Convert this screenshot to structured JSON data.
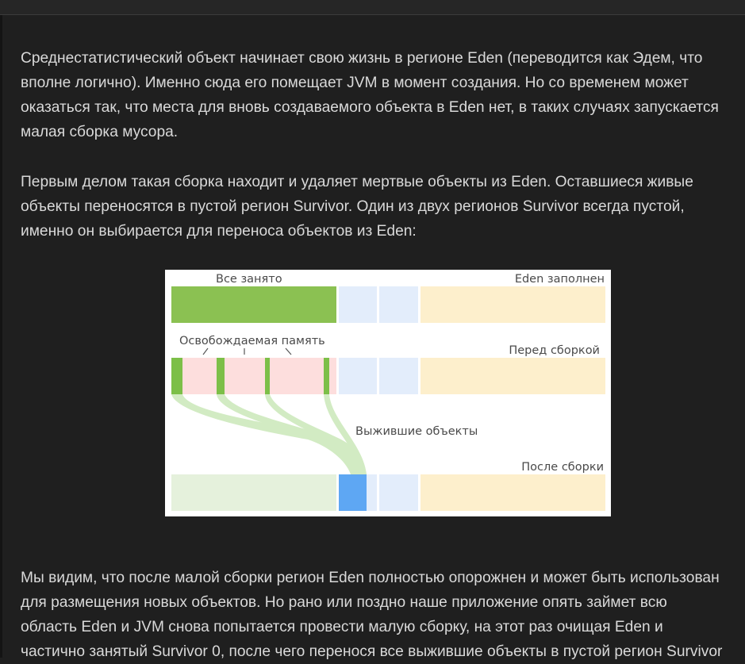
{
  "article": {
    "paragraphs": [
      {
        "lines": [
          "Среднестатистический объект начинает свою жизнь в регионе Eden (переводится как Эдем, что",
          "вполне логично). Именно сюда его помещает JVM в момент создания. Но со временем может",
          "оказаться так, что места для вновь создаваемого объекта в Eden нет, в таких случаях запускается",
          "малая сборка мусора."
        ]
      },
      {
        "lines": [
          "Первым делом такая сборка находит и удаляет мертвые объекты из Eden. Оставшиеся живые",
          "объекты переносятся в пустой регион Survivor. Один из двух регионов Survivor всегда пустой,",
          "именно он выбирается для переноса объектов из Eden:"
        ]
      },
      {
        "lines": [
          "Мы видим, что после малой сборки регион Eden полностью опорожнен и может быть использован",
          "для размещения новых объектов. Но рано или поздно наше приложение опять займет всю",
          "область Eden и JVM снова попытается провести малую сборку, на этот раз очищая Eden и",
          "частично занятый Survivor 0, после чего перенося все выжившие объекты в пустой регион Survivor"
        ]
      }
    ]
  },
  "diagram": {
    "label_all_occupied": "Все занято",
    "label_eden_full": "Eden заполнен",
    "label_freed_memory": "Освобождаемая память",
    "label_before_gc": "Перед сборкой",
    "label_survivors": "Выжившие объекты",
    "label_after_gc": "После сборки",
    "colors": {
      "eden_full": "#8bc152",
      "survivor": "#e3edfb",
      "old_gen": "#fdefcc",
      "freed": "#fddedd",
      "live_object": "#7cbf48",
      "flow": "#d2ebc3",
      "eden_empty": "#e5f1dc",
      "survivor_filled": "#5ea7f3"
    }
  }
}
